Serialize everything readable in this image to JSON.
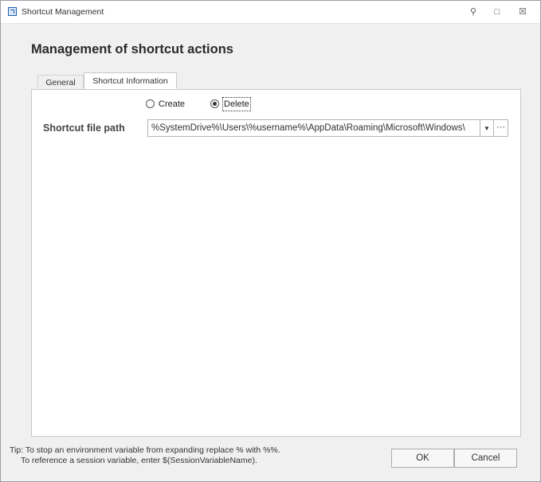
{
  "window": {
    "title": "Shortcut Management",
    "controls": {
      "pin": "⚲",
      "maximize": "□",
      "close": "☒"
    }
  },
  "header": {
    "title": "Management of shortcut actions"
  },
  "tabs": [
    {
      "label": "General",
      "active": false
    },
    {
      "label": "Shortcut Information",
      "active": true
    }
  ],
  "action": {
    "options": [
      {
        "label": "Create",
        "selected": false
      },
      {
        "label": "Delete",
        "selected": true
      }
    ]
  },
  "shortcut_path": {
    "label": "Shortcut file path",
    "value": "%SystemDrive%\\Users\\%username%\\AppData\\Roaming\\Microsoft\\Windows\\",
    "dropdown_glyph": "▼",
    "browse_glyph": "···"
  },
  "tip": {
    "line1": "Tip: To stop an environment variable from expanding replace % with %%.",
    "line2": "To reference a session variable, enter $(SessionVariableName)."
  },
  "buttons": {
    "ok": "OK",
    "cancel": "Cancel"
  }
}
